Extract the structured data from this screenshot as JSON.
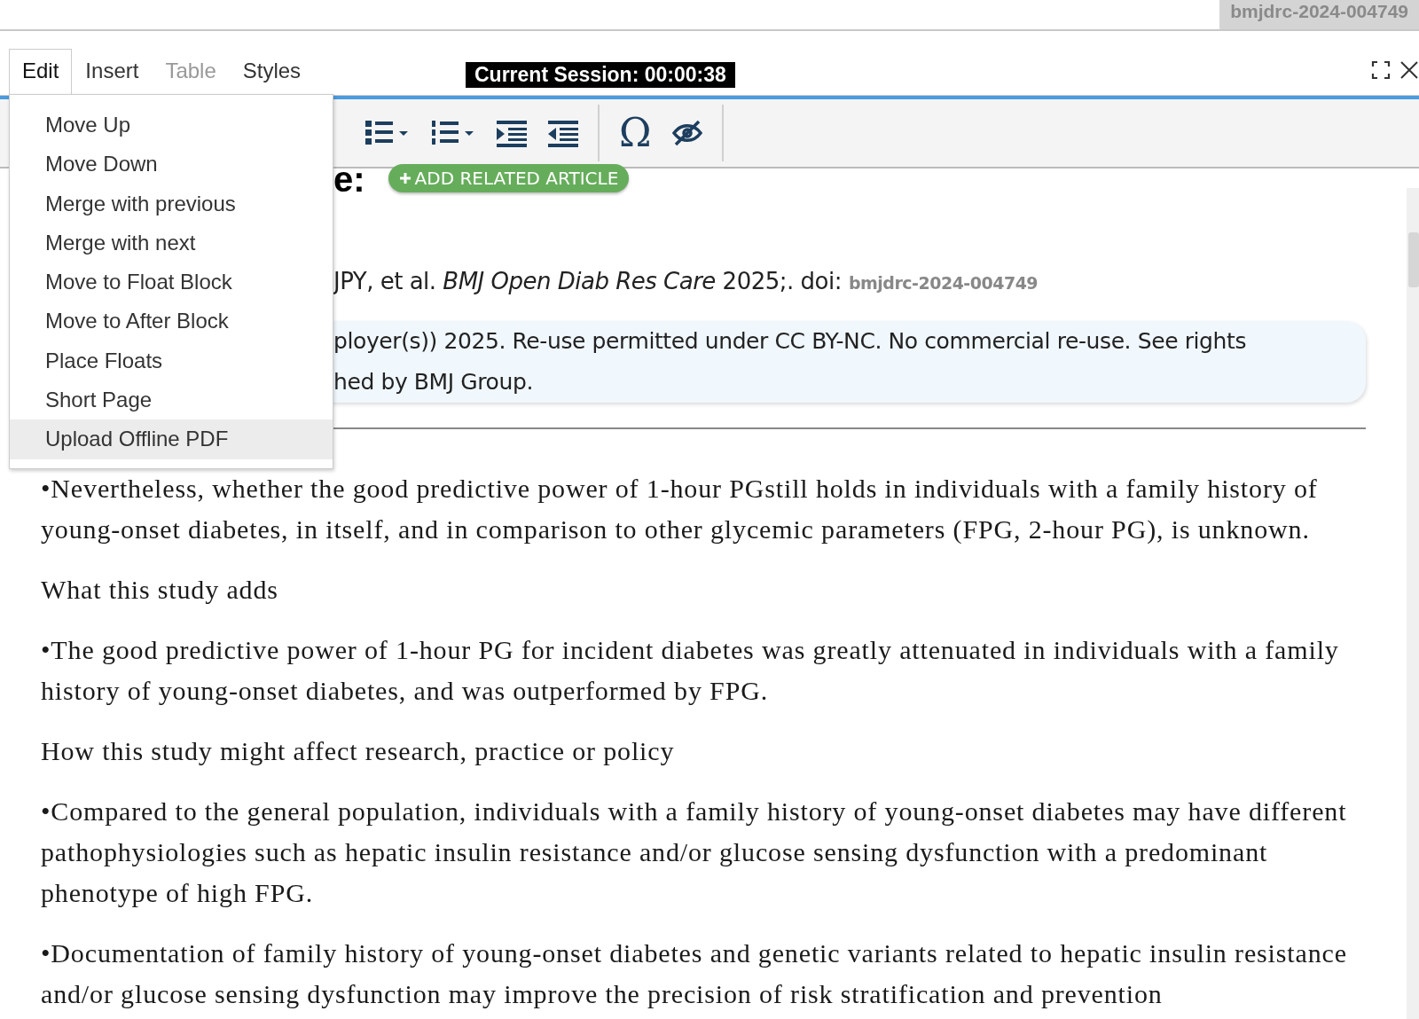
{
  "top_tag": "bmjdrc-2024-004749",
  "menu_tabs": [
    {
      "label": "Edit",
      "selected": true,
      "disabled": false
    },
    {
      "label": "Insert",
      "selected": false,
      "disabled": false
    },
    {
      "label": "Table",
      "selected": false,
      "disabled": true
    },
    {
      "label": "Styles",
      "selected": false,
      "disabled": false
    }
  ],
  "session": "Current Session: 00:00:38",
  "toolbar": [
    {
      "kind": "bullet-list"
    },
    {
      "kind": "numbered-list"
    },
    {
      "kind": "indent"
    },
    {
      "kind": "outdent"
    },
    {
      "kind": "separator"
    },
    {
      "kind": "symbol",
      "glyph": "Ω"
    },
    {
      "kind": "hide"
    },
    {
      "kind": "separator"
    }
  ],
  "dropdown": [
    {
      "label": "Move Up",
      "selected": false
    },
    {
      "label": "Move Down",
      "selected": false
    },
    {
      "label": "Merge with previous",
      "selected": false
    },
    {
      "label": "Merge with next",
      "selected": false
    },
    {
      "label": "Move to Float Block",
      "selected": false
    },
    {
      "label": "Move to After Block",
      "selected": false
    },
    {
      "label": "Place Floats",
      "selected": false
    },
    {
      "label": "Short Page",
      "selected": false
    },
    {
      "label": "Upload Offline PDF",
      "selected": true
    }
  ],
  "heading_fragment": "e:",
  "add_related_button": "ADD RELATED ARTICLE",
  "citation": {
    "text": "JPY, et al. *BMJ Open Diab Res Care* 2025;. doi:",
    "doi": "bmjdrc-2024-004749"
  },
  "license_lines": [
    "ployer(s)) 2025. Re-use permitted under CC BY-NC. No commercial re-use. See rights",
    "hed by BMJ Group."
  ],
  "paragraphs": [
    "•Nevertheless, whether the good predictive power of 1-hour PGstill holds in individuals with a family history of young-onset diabetes, in itself, and in comparison to other glycemic parameters (FPG, 2-hour PG), is unknown.",
    "What this study adds",
    "•The good predictive power of 1-hour PG for incident diabetes was greatly attenuated in individuals with a family history of young-onset diabetes, and was outperformed by FPG.",
    "How this study might affect research, practice or policy",
    "•Compared to the general population, individuals with a family history of young-onset diabetes may have different pathophysiologies such as hepatic insulin resistance and/or glucose sensing dysfunction with a predominant phenotype of high FPG.",
    "•Documentation of family history of young-onset diabetes and genetic variants related to hepatic insulin resistance and/or glucose sensing dysfunction may improve the precision of risk stratification and prevention"
  ]
}
